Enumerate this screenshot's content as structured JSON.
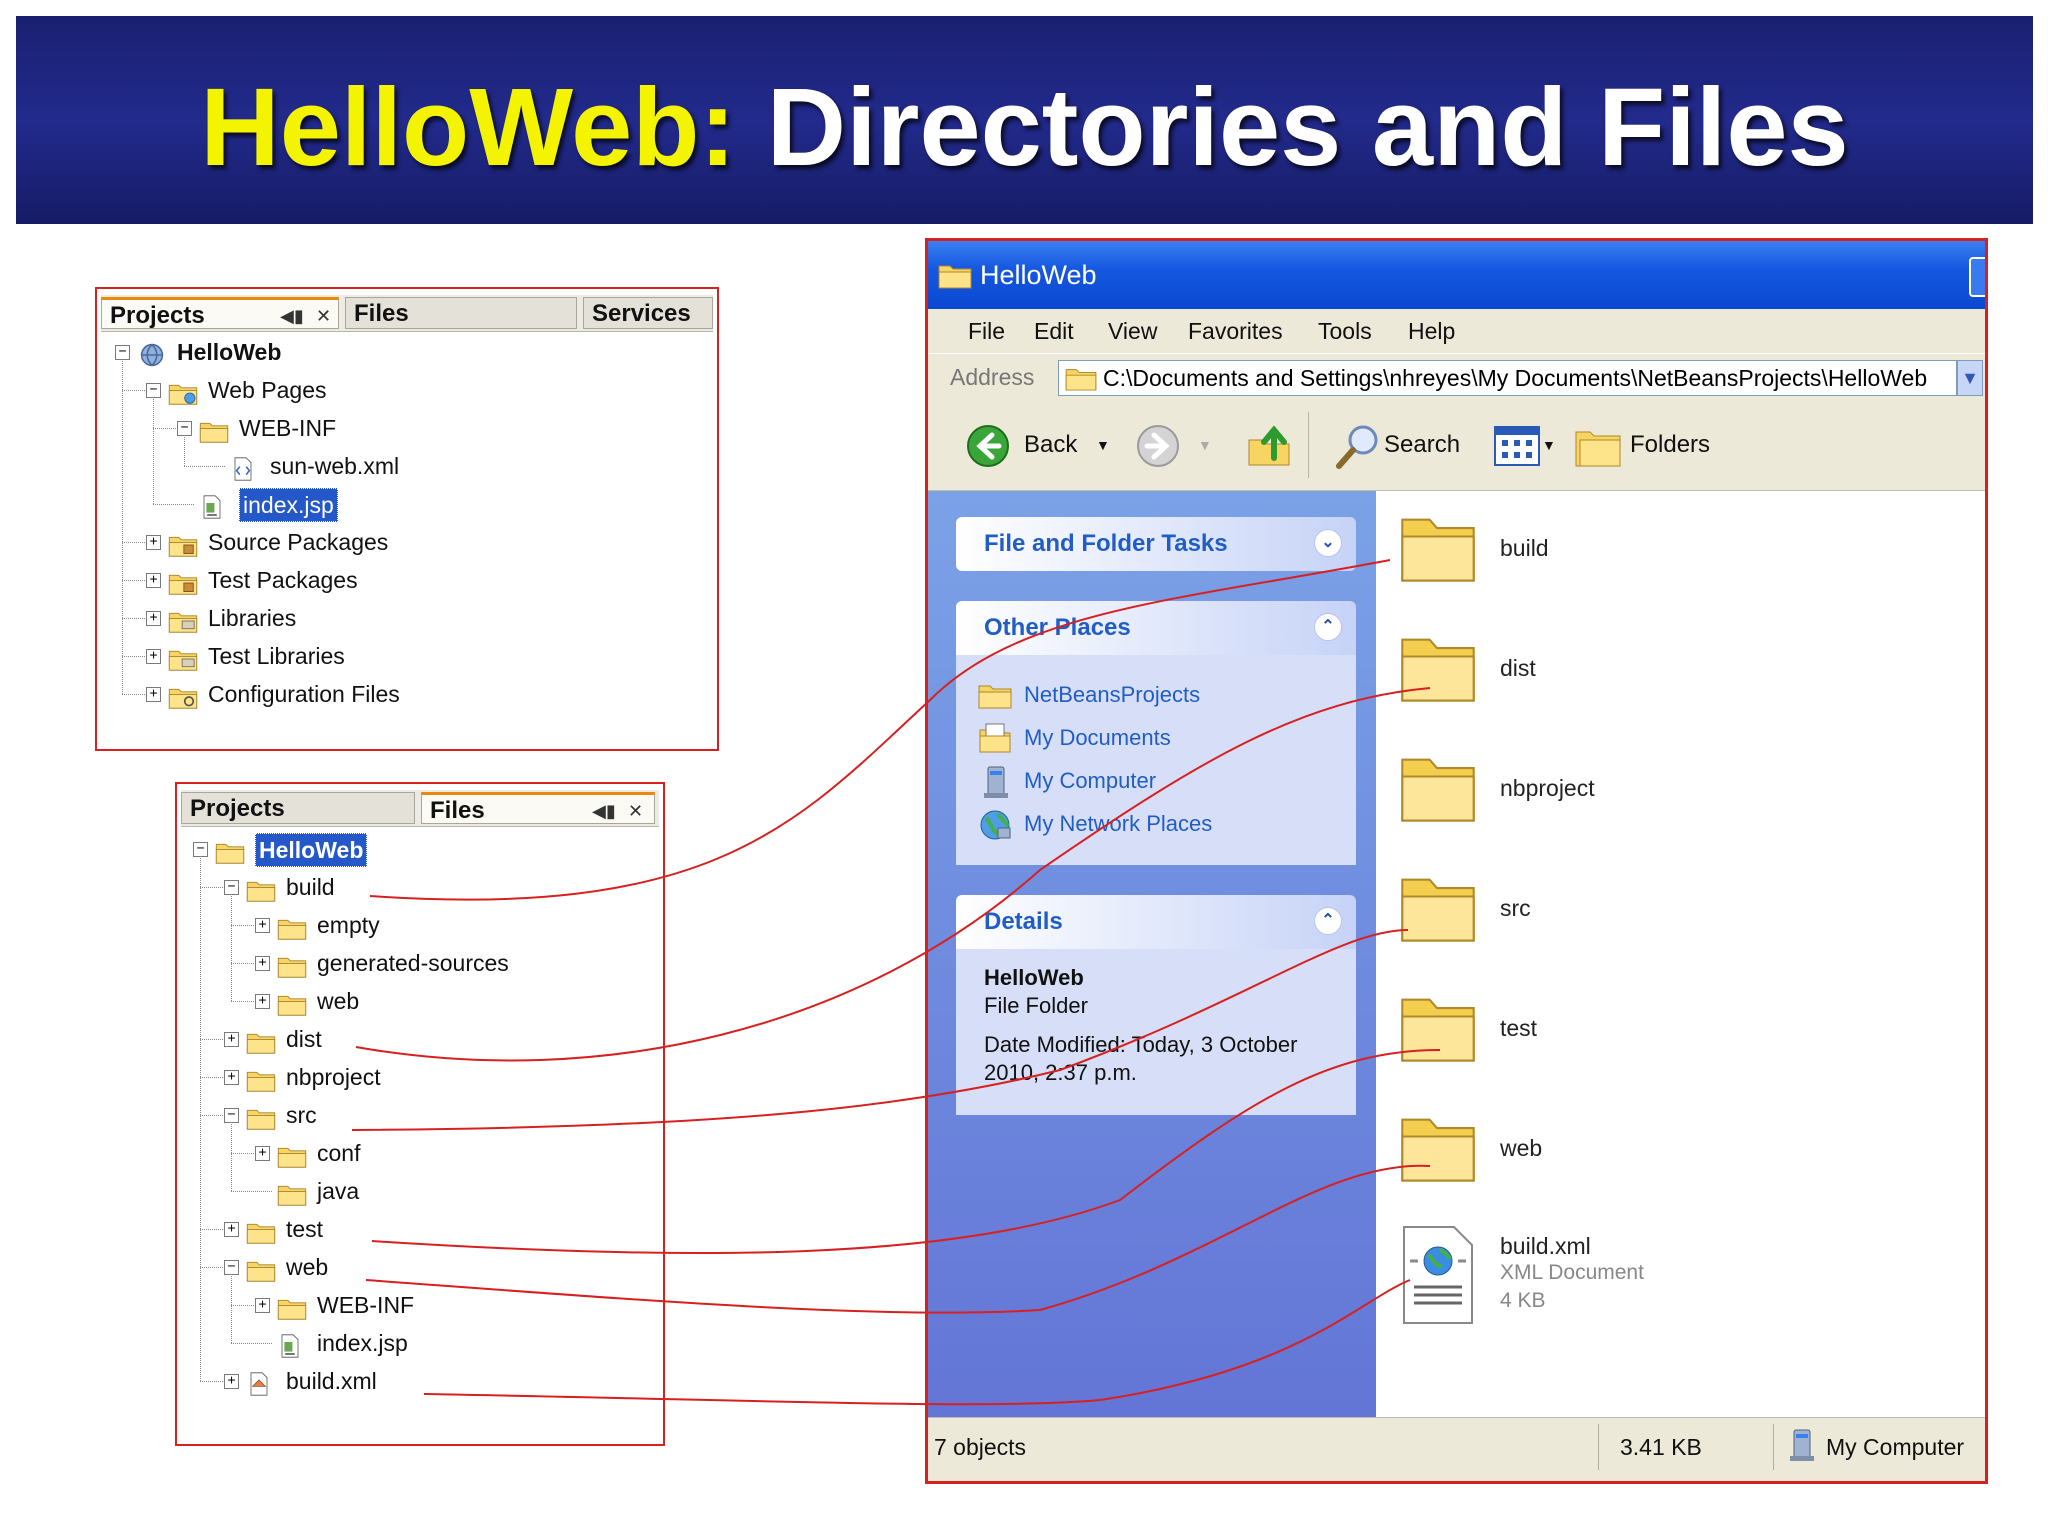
{
  "slide": {
    "title_highlight": "HelloWeb:",
    "title_rest": " Directories and Files"
  },
  "projects_panel": {
    "tabs": [
      "Projects",
      "Files",
      "Services"
    ],
    "tree": [
      {
        "label": "HelloWeb",
        "depth": 0,
        "expander": "minus",
        "icon": "globe-icon",
        "bold": true
      },
      {
        "label": "Web Pages",
        "depth": 1,
        "expander": "minus",
        "icon": "web-folder-icon"
      },
      {
        "label": "WEB-INF",
        "depth": 2,
        "expander": "minus",
        "icon": "folder-icon"
      },
      {
        "label": "sun-web.xml",
        "depth": 3,
        "expander": "",
        "icon": "xml-file-icon"
      },
      {
        "label": "index.jsp",
        "depth": 2,
        "expander": "",
        "icon": "jsp-file-icon",
        "selected": true
      },
      {
        "label": "Source Packages",
        "depth": 1,
        "expander": "plus",
        "icon": "package-folder-icon"
      },
      {
        "label": "Test Packages",
        "depth": 1,
        "expander": "plus",
        "icon": "package-folder-icon"
      },
      {
        "label": "Libraries",
        "depth": 1,
        "expander": "plus",
        "icon": "library-folder-icon"
      },
      {
        "label": "Test Libraries",
        "depth": 1,
        "expander": "plus",
        "icon": "library-folder-icon"
      },
      {
        "label": "Configuration Files",
        "depth": 1,
        "expander": "plus",
        "icon": "config-folder-icon"
      }
    ]
  },
  "files_panel": {
    "tabs": [
      "Projects",
      "Files"
    ],
    "tree": [
      {
        "label": "HelloWeb",
        "depth": 0,
        "expander": "minus",
        "icon": "folder-icon",
        "bold": true,
        "selected": true
      },
      {
        "label": "build",
        "depth": 1,
        "expander": "minus",
        "icon": "folder-icon"
      },
      {
        "label": "empty",
        "depth": 2,
        "expander": "plus",
        "icon": "folder-icon"
      },
      {
        "label": "generated-sources",
        "depth": 2,
        "expander": "plus",
        "icon": "folder-icon"
      },
      {
        "label": "web",
        "depth": 2,
        "expander": "plus",
        "icon": "folder-icon"
      },
      {
        "label": "dist",
        "depth": 1,
        "expander": "plus",
        "icon": "folder-icon"
      },
      {
        "label": "nbproject",
        "depth": 1,
        "expander": "plus",
        "icon": "folder-icon"
      },
      {
        "label": "src",
        "depth": 1,
        "expander": "minus",
        "icon": "folder-icon"
      },
      {
        "label": "conf",
        "depth": 2,
        "expander": "plus",
        "icon": "folder-icon"
      },
      {
        "label": "java",
        "depth": 2,
        "expander": "",
        "icon": "folder-icon"
      },
      {
        "label": "test",
        "depth": 1,
        "expander": "plus",
        "icon": "folder-icon"
      },
      {
        "label": "web",
        "depth": 1,
        "expander": "minus",
        "icon": "folder-icon"
      },
      {
        "label": "WEB-INF",
        "depth": 2,
        "expander": "plus",
        "icon": "folder-icon"
      },
      {
        "label": "index.jsp",
        "depth": 2,
        "expander": "",
        "icon": "jsp-file-icon"
      },
      {
        "label": "build.xml",
        "depth": 1,
        "expander": "plus",
        "icon": "ant-build-icon"
      }
    ]
  },
  "explorer": {
    "title": "HelloWeb",
    "menu": [
      "File",
      "Edit",
      "View",
      "Favorites",
      "Tools",
      "Help"
    ],
    "address_label": "Address",
    "address_value": "C:\\Documents and Settings\\nhreyes\\My Documents\\NetBeansProjects\\HelloWeb",
    "toolbar": {
      "back": "Back",
      "search": "Search",
      "folders": "Folders"
    },
    "tasks": {
      "file_folder_tasks": "File and Folder Tasks",
      "other_places": "Other Places",
      "places": [
        {
          "label": "NetBeansProjects",
          "icon": "folder-icon"
        },
        {
          "label": "My Documents",
          "icon": "my-documents-icon"
        },
        {
          "label": "My Computer",
          "icon": "my-computer-icon"
        },
        {
          "label": "My Network Places",
          "icon": "network-places-icon"
        }
      ],
      "details_heading": "Details",
      "details_name": "HelloWeb",
      "details_type": "File Folder",
      "details_modified": "Date Modified: Today, 3 October 2010, 2:37 p.m."
    },
    "items": [
      {
        "name": "build",
        "icon": "folder-icon"
      },
      {
        "name": "dist",
        "icon": "folder-icon"
      },
      {
        "name": "nbproject",
        "icon": "folder-icon"
      },
      {
        "name": "src",
        "icon": "folder-icon"
      },
      {
        "name": "test",
        "icon": "folder-icon"
      },
      {
        "name": "web",
        "icon": "folder-icon"
      },
      {
        "name": "build.xml",
        "icon": "xml-document-icon",
        "type": "XML Document",
        "size": "4 KB"
      }
    ],
    "status": {
      "objects": "7 objects",
      "size": "3.41 KB",
      "location": "My Computer"
    }
  },
  "colors": {
    "banner": "#222a8c",
    "title_highlight": "#f4f400",
    "connector": "#d72020",
    "xp_sidebar": "#6f8fe0",
    "xp_link": "#215dc6"
  }
}
